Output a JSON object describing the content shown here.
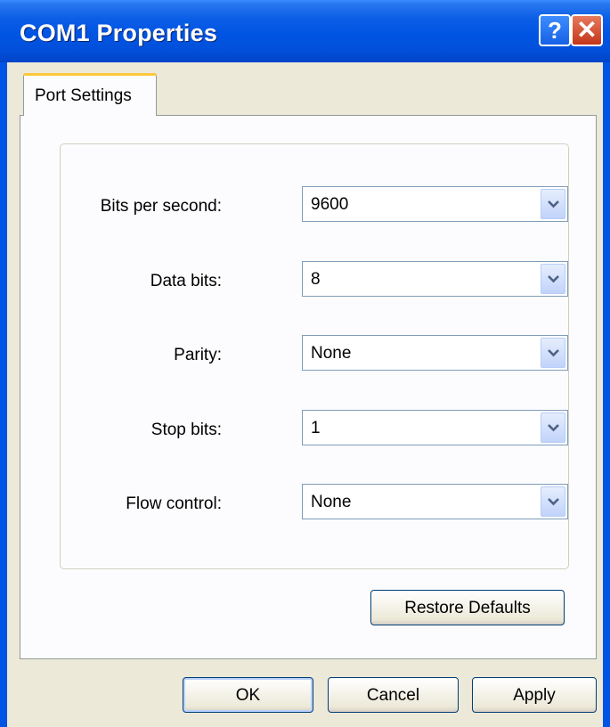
{
  "window": {
    "title": "COM1 Properties"
  },
  "titlebar": {
    "help_glyph": "?",
    "close_glyph": "✕"
  },
  "tabs": [
    {
      "label": "Port Settings",
      "selected": true
    }
  ],
  "settings": [
    {
      "label": "Bits per second:",
      "value": "9600"
    },
    {
      "label": "Data bits:",
      "value": "8"
    },
    {
      "label": "Parity:",
      "value": "None"
    },
    {
      "label": "Stop bits:",
      "value": "1"
    },
    {
      "label": "Flow control:",
      "value": "None"
    }
  ],
  "buttons": {
    "restore_defaults": "Restore Defaults",
    "ok": "OK",
    "cancel": "Cancel",
    "apply": "Apply"
  },
  "icons": {
    "help": "help-icon",
    "close": "close-icon",
    "dropdown": "chevron-down-icon"
  },
  "colors": {
    "title_bar": "#0054e3",
    "dialog_bg": "#ece9d8",
    "tab_highlight": "#ffc83c"
  }
}
